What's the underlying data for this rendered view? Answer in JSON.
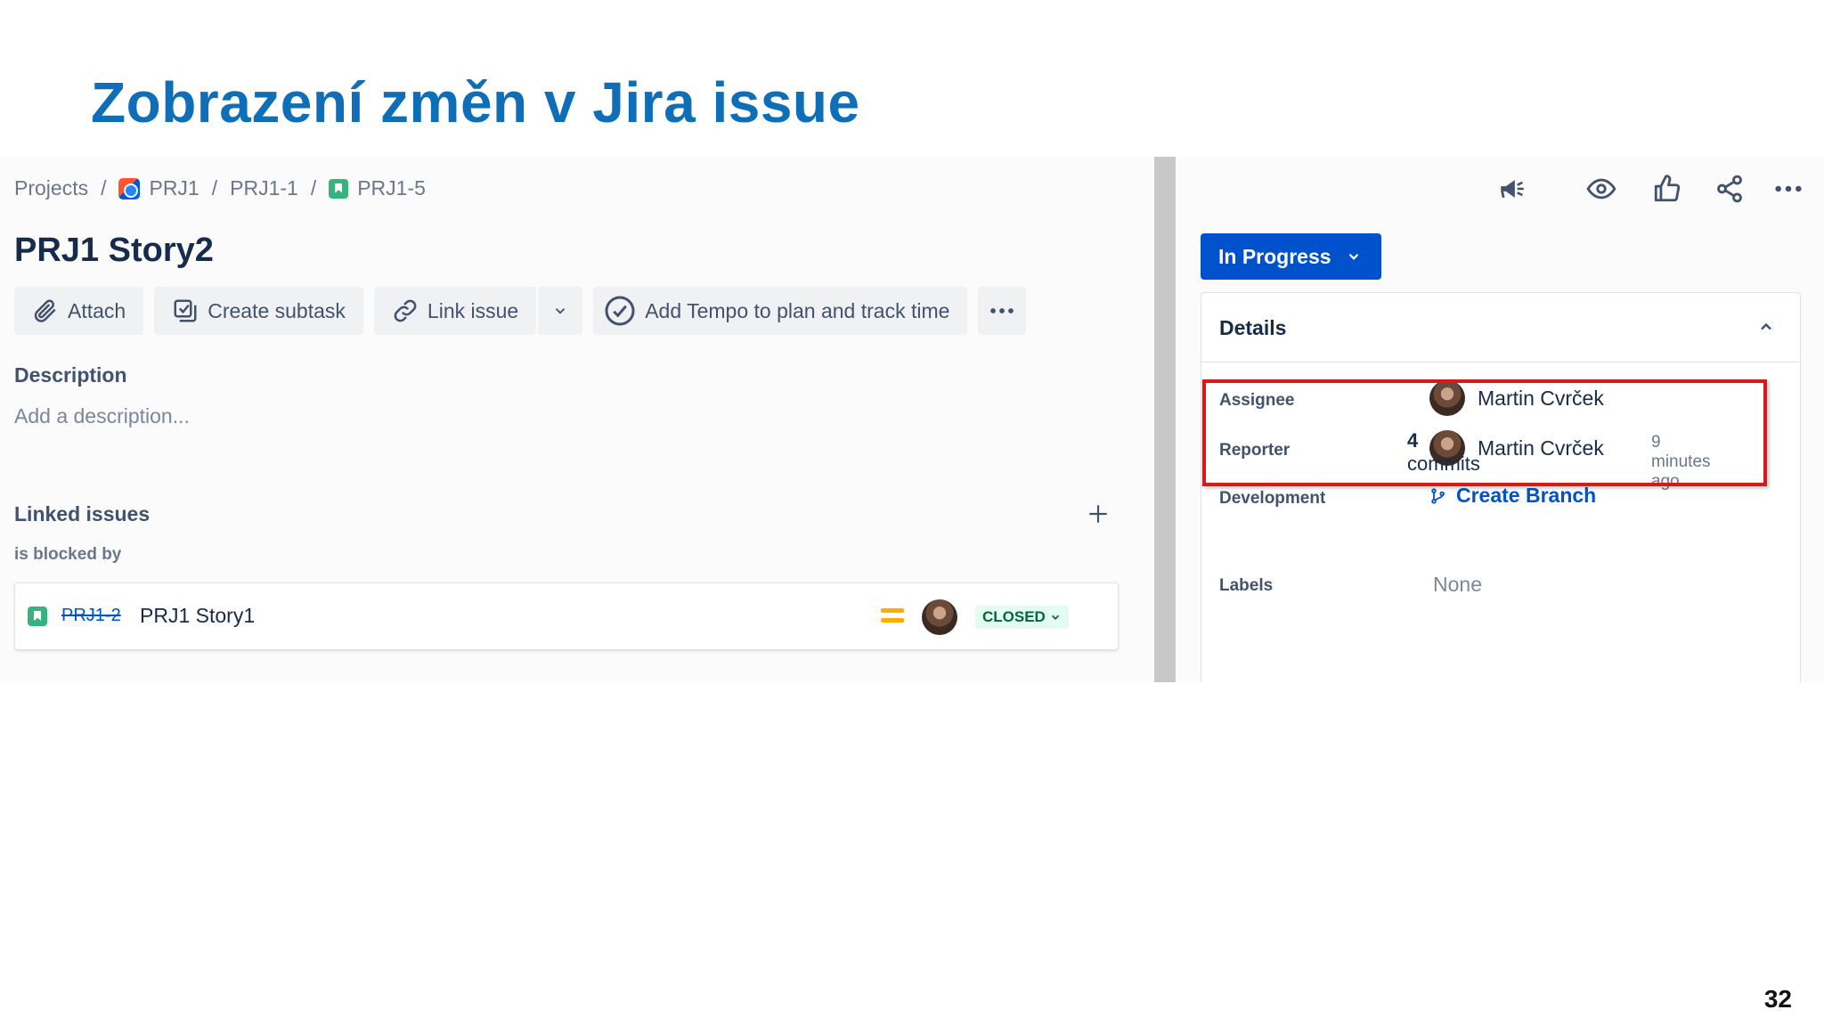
{
  "slide": {
    "title": "Zobrazení změn v Jira issue",
    "page_number": "32"
  },
  "breadcrumb": {
    "items": [
      {
        "label": "Projects",
        "icon": null
      },
      {
        "label": "PRJ1",
        "icon": "project-icon"
      },
      {
        "label": "PRJ1-1",
        "icon": null
      },
      {
        "label": "PRJ1-5",
        "icon": "story-icon"
      }
    ],
    "separator": "/"
  },
  "issue": {
    "title": "PRJ1 Story2"
  },
  "toolbar": {
    "attach": "Attach",
    "create_subtask": "Create subtask",
    "link_issue": "Link issue",
    "tempo": "Add Tempo to plan and track time"
  },
  "description": {
    "label": "Description",
    "placeholder": "Add a description..."
  },
  "linked_issues": {
    "label": "Linked issues",
    "relation": "is blocked by",
    "items": [
      {
        "key": "PRJ1-2",
        "summary": "PRJ1 Story1",
        "status": "CLOSED",
        "priority": "medium"
      }
    ]
  },
  "right_panel": {
    "status_button": "In Progress",
    "details": {
      "title": "Details",
      "assignee_label": "Assignee",
      "assignee": "Martin Cvrček",
      "reporter_label": "Reporter",
      "reporter": "Martin Cvrček",
      "development_label": "Development",
      "create_branch": "Create Branch",
      "commits_count": "4",
      "commits_word": "commits",
      "commits_time": "9 minutes ago",
      "labels_label": "Labels",
      "labels_value": "None"
    }
  },
  "colors": {
    "title_blue": "#0e6eb8",
    "jira_blue": "#0052cc",
    "highlight_red": "#d61a1a",
    "closed_green": "#006644"
  }
}
